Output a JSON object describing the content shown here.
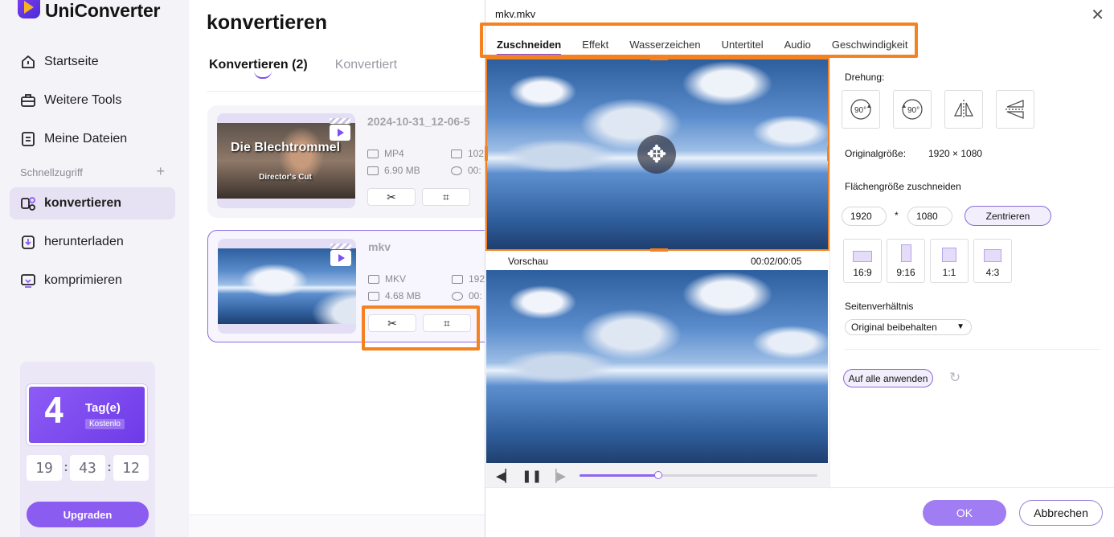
{
  "app": {
    "name": "UniConverter"
  },
  "sidebar": {
    "items": [
      {
        "label": "Startseite",
        "icon": "home-icon"
      },
      {
        "label": "Weitere Tools",
        "icon": "toolbox-icon"
      },
      {
        "label": "Meine Dateien",
        "icon": "files-icon"
      }
    ],
    "quick_access_label": "Schnellzugriff",
    "quick_items": [
      {
        "label": "konvertieren",
        "icon": "convert-icon",
        "active": true
      },
      {
        "label": "herunterladen",
        "icon": "download-icon"
      },
      {
        "label": "komprimieren",
        "icon": "compress-icon"
      }
    ],
    "promo": {
      "days_number": "4",
      "days_label": "Tag(e)",
      "badge": "Kostenlo",
      "timer": {
        "hours": "19",
        "minutes": "43",
        "seconds": "12"
      },
      "upgrade_label": "Upgraden"
    }
  },
  "main": {
    "title": "konvertieren",
    "tabs": {
      "converting": "Konvertieren (2)",
      "converted": "Konvertiert"
    },
    "files": [
      {
        "name": "2024-10-31_12-06-5",
        "thumb_title": "Die Blechtrommel",
        "thumb_subtitle": "Director's Cut",
        "format": "MP4",
        "size": "6.90 MB",
        "resolution": "102",
        "duration": "00:"
      },
      {
        "name": "mkv",
        "format": "MKV",
        "size": "4.68 MB",
        "resolution": "192",
        "duration": "00:"
      }
    ]
  },
  "dialog": {
    "title": "mkv.mkv",
    "tabs": [
      "Zuschneiden",
      "Effekt",
      "Wasserzeichen",
      "Untertitel",
      "Audio",
      "Geschwindigkeit"
    ],
    "preview_label": "Vorschau",
    "preview_time": "00:02/00:05",
    "playback": {
      "progress": 0.33
    },
    "rotation_label": "Drehung:",
    "rotate_left_text": "90°",
    "rotate_right_text": "90°",
    "original_size_label": "Originalgröße:",
    "original_size_value": "1920 × 1080",
    "crop_area_label": "Flächengröße zuschneiden",
    "crop_width": "1920",
    "crop_times": "*",
    "crop_height": "1080",
    "center_label": "Zentrieren",
    "ratios": [
      "16:9",
      "9:16",
      "1:1",
      "4:3"
    ],
    "aspect_label": "Seitenverhältnis",
    "aspect_value": "Original beibehalten",
    "apply_all_label": "Auf alle anwenden",
    "ok_label": "OK",
    "cancel_label": "Abbrechen"
  },
  "colors": {
    "accent": "#7c4ff0",
    "highlight": "#f58220",
    "button": "#a07df3"
  }
}
